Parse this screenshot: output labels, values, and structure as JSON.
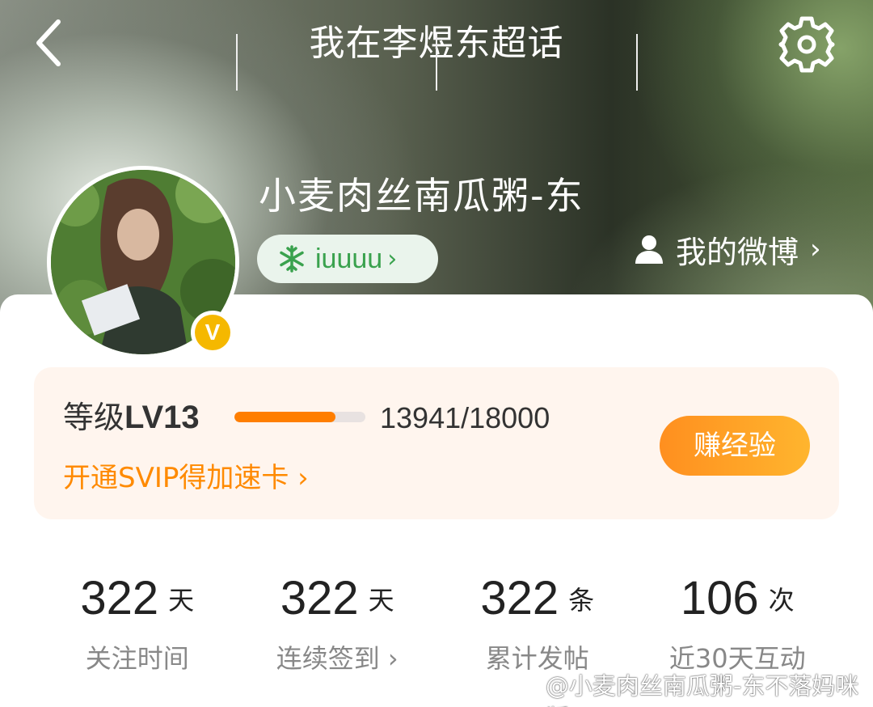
{
  "header": {
    "title": "我在李煜东超话",
    "back_icon": "chevron-left-icon",
    "settings_icon": "gear-icon"
  },
  "profile": {
    "username": "小麦肉丝南瓜粥-东",
    "tag": {
      "icon": "snowflake-icon",
      "label": "iuuuu",
      "chevron": "›"
    },
    "verified_badge": "V",
    "my_weibo": {
      "icon": "user-icon",
      "label": "我的微博",
      "chevron": "›"
    }
  },
  "level": {
    "label": "等级",
    "value": "LV13",
    "exp_current": 13941,
    "exp_max": 18000,
    "exp_text": "13941/18000",
    "progress_fraction": 0.7745,
    "svip_link": "开通SVIP得加速卡 ›",
    "earn_button": "赚经验",
    "accent_color": "#ff7e00"
  },
  "stats": [
    {
      "value": "322",
      "unit": "天",
      "label": "关注时间"
    },
    {
      "value": "322",
      "unit": "天",
      "label": "连续签到 ›"
    },
    {
      "value": "322",
      "unit": "条",
      "label": "累计发帖"
    },
    {
      "value": "106",
      "unit": "次",
      "label": "近30天互动"
    }
  ],
  "watermark": "@小麦肉丝南瓜粥-东不落妈咪版"
}
